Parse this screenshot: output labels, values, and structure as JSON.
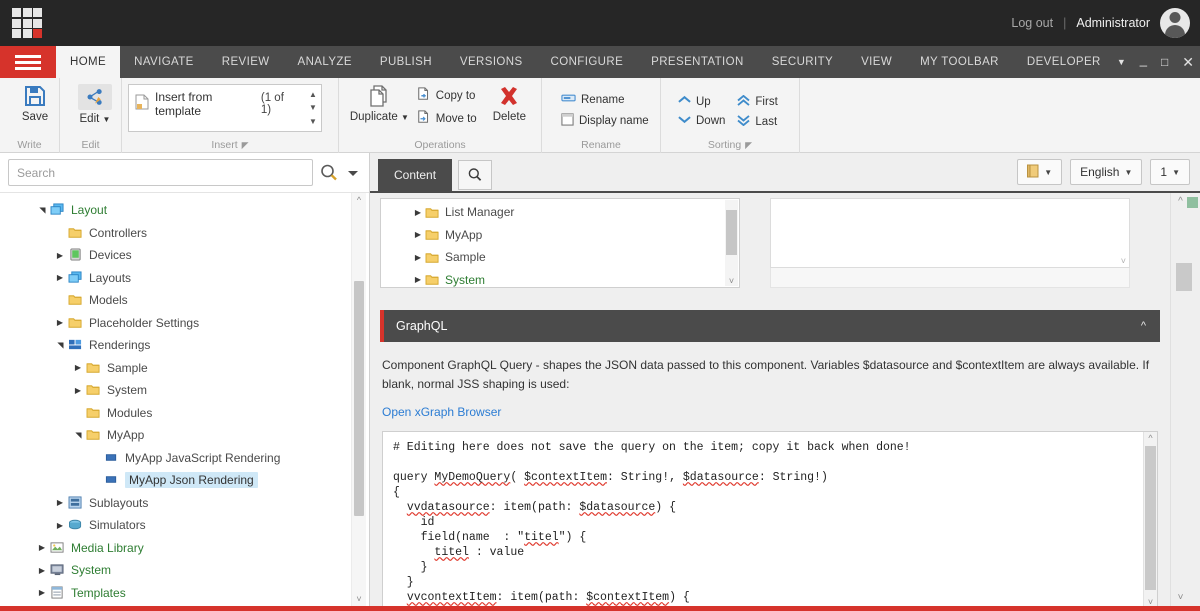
{
  "topbar": {
    "logout": "Log out",
    "separator": "|",
    "username": "Administrator"
  },
  "ribbon": {
    "tabs": [
      {
        "label": "HOME",
        "active": true
      },
      {
        "label": "NAVIGATE",
        "active": false
      },
      {
        "label": "REVIEW",
        "active": false
      },
      {
        "label": "ANALYZE",
        "active": false
      },
      {
        "label": "PUBLISH",
        "active": false
      },
      {
        "label": "VERSIONS",
        "active": false
      },
      {
        "label": "CONFIGURE",
        "active": false
      },
      {
        "label": "PRESENTATION",
        "active": false
      },
      {
        "label": "SECURITY",
        "active": false
      },
      {
        "label": "VIEW",
        "active": false
      },
      {
        "label": "MY TOOLBAR",
        "active": false
      },
      {
        "label": "DEVELOPER",
        "active": false
      }
    ],
    "groups": {
      "write": {
        "title": "Write",
        "save": "Save"
      },
      "edit": {
        "title": "Edit",
        "edit": "Edit"
      },
      "insert": {
        "title": "Insert",
        "template_label": "Insert from template",
        "count": "(1 of 1)"
      },
      "operations": {
        "title": "Operations",
        "duplicate": "Duplicate",
        "copy_to": "Copy to",
        "move_to": "Move to",
        "delete": "Delete"
      },
      "rename": {
        "title": "Rename",
        "rename": "Rename",
        "display_name": "Display name"
      },
      "sorting": {
        "title": "Sorting",
        "up": "Up",
        "down": "Down",
        "first": "First",
        "last": "Last"
      }
    }
  },
  "left_panel": {
    "search": {
      "placeholder": "Search",
      "value": ""
    },
    "tree": [
      {
        "label": "Layout",
        "indent": 1,
        "arrow": "open",
        "icon": "layout",
        "color": "green"
      },
      {
        "label": "Controllers",
        "indent": 2,
        "arrow": "none",
        "icon": "folder",
        "color": "grey"
      },
      {
        "label": "Devices",
        "indent": 2,
        "arrow": "closed",
        "icon": "device",
        "color": "grey"
      },
      {
        "label": "Layouts",
        "indent": 2,
        "arrow": "closed",
        "icon": "layout",
        "color": "grey"
      },
      {
        "label": "Models",
        "indent": 2,
        "arrow": "none",
        "icon": "folder",
        "color": "grey"
      },
      {
        "label": "Placeholder Settings",
        "indent": 2,
        "arrow": "closed",
        "icon": "folder",
        "color": "grey"
      },
      {
        "label": "Renderings",
        "indent": 2,
        "arrow": "open",
        "icon": "rendering",
        "color": "grey"
      },
      {
        "label": "Sample",
        "indent": 3,
        "arrow": "closed",
        "icon": "folder",
        "color": "grey"
      },
      {
        "label": "System",
        "indent": 3,
        "arrow": "closed",
        "icon": "folder",
        "color": "grey"
      },
      {
        "label": "Modules",
        "indent": 3,
        "arrow": "none",
        "icon": "folder",
        "color": "grey"
      },
      {
        "label": "MyApp",
        "indent": 3,
        "arrow": "open",
        "icon": "folder",
        "color": "grey"
      },
      {
        "label": "MyApp JavaScript Rendering",
        "indent": 4,
        "arrow": "none",
        "icon": "item",
        "color": "grey"
      },
      {
        "label": "MyApp Json Rendering",
        "indent": 4,
        "arrow": "none",
        "icon": "item",
        "color": "grey",
        "selected": true
      },
      {
        "label": "Sublayouts",
        "indent": 2,
        "arrow": "closed",
        "icon": "sublayout",
        "color": "grey"
      },
      {
        "label": "Simulators",
        "indent": 2,
        "arrow": "closed",
        "icon": "simulator",
        "color": "grey"
      },
      {
        "label": "Media Library",
        "indent": 1,
        "arrow": "closed",
        "icon": "media",
        "color": "green"
      },
      {
        "label": "System",
        "indent": 1,
        "arrow": "closed",
        "icon": "system",
        "color": "green"
      },
      {
        "label": "Templates",
        "indent": 1,
        "arrow": "closed",
        "icon": "template",
        "color": "green"
      }
    ]
  },
  "content_header": {
    "tab": "Content",
    "search_icon": "search-icon",
    "buttons": [
      {
        "name": "notes-button",
        "label": ""
      },
      {
        "name": "language-button",
        "label": "English"
      },
      {
        "name": "version-button",
        "label": "1"
      }
    ]
  },
  "datasource_list": [
    {
      "label": "List Manager",
      "color": "grey"
    },
    {
      "label": "MyApp",
      "color": "grey"
    },
    {
      "label": "Sample",
      "color": "grey"
    },
    {
      "label": "System",
      "color": "green"
    }
  ],
  "graphql_section": {
    "title": "GraphQL",
    "collapse_icon": "chevron-up-icon",
    "description": "Component GraphQL Query - shapes the JSON data passed to this component. Variables $datasource and $contextItem are always available. If blank, normal JSS shaping is used:",
    "link": "Open xGraph Browser",
    "code_lines": [
      "# Editing here does not save the query on the item; copy it back when done!",
      "",
      "query MyDemoQuery( $contextItem: String!, $datasource: String!)",
      "{",
      "  vvdatasource: item(path: $datasource) {",
      "    id",
      "    field(name  : \"titel\") {",
      "      titel : value",
      "    }",
      "  }",
      "  vvcontextItem: item(path: $contextItem) {"
    ]
  },
  "colors": {
    "accent_red": "#d6332b",
    "dark_bar": "#262626",
    "ribbon_dark": "#4b4b4b",
    "link_blue": "#2b7cd3",
    "tree_green": "#2e7d32",
    "selection_blue": "#cfe8f7"
  }
}
